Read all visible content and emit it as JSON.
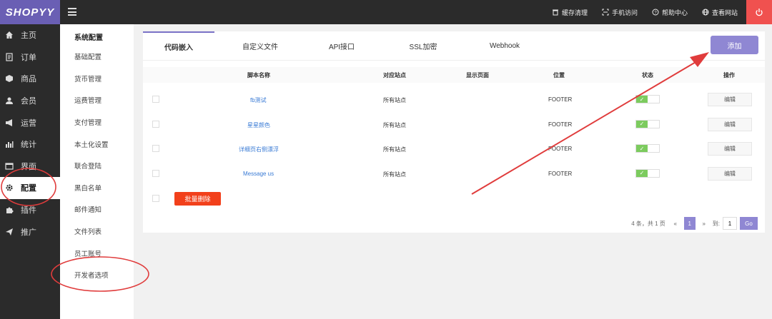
{
  "app": {
    "logo": "SHOPYY"
  },
  "topbar": {
    "links": [
      {
        "label": "缓存清理",
        "icon": "trash-icon"
      },
      {
        "label": "手机访问",
        "icon": "scan-icon"
      },
      {
        "label": "帮助中心",
        "icon": "help-icon"
      },
      {
        "label": "查看网站",
        "icon": "globe-icon"
      }
    ],
    "power_icon": "power-icon"
  },
  "sidebar": {
    "items": [
      {
        "label": "主页",
        "icon": "home-icon"
      },
      {
        "label": "订单",
        "icon": "order-icon"
      },
      {
        "label": "商品",
        "icon": "box-icon"
      },
      {
        "label": "会员",
        "icon": "user-icon"
      },
      {
        "label": "运营",
        "icon": "megaphone-icon"
      },
      {
        "label": "统计",
        "icon": "chart-icon"
      },
      {
        "label": "界面",
        "icon": "layout-icon"
      },
      {
        "label": "配置",
        "icon": "gear-icon"
      },
      {
        "label": "插件",
        "icon": "puzzle-icon"
      },
      {
        "label": "推广",
        "icon": "send-icon"
      }
    ]
  },
  "submenu": {
    "title": "系统配置",
    "items": [
      "基础配置",
      "货币管理",
      "运费管理",
      "支付管理",
      "本土化设置",
      "联合登陆",
      "黑白名单",
      "邮件通知",
      "文件列表",
      "员工账号",
      "开发者选项"
    ]
  },
  "tabs": [
    "代码嵌入",
    "自定义文件",
    "API接口",
    "SSL加密",
    "Webhook"
  ],
  "toolbar": {
    "add_label": "添加"
  },
  "table": {
    "headers": [
      "脚本名称",
      "对应站点",
      "显示页面",
      "位置",
      "状态",
      "操作"
    ],
    "rows": [
      {
        "name": "fb测试",
        "site": "所有站点",
        "page": "",
        "position": "FOOTER",
        "edit": "编辑"
      },
      {
        "name": "星星颜色",
        "site": "所有站点",
        "page": "",
        "position": "FOOTER",
        "edit": "编辑"
      },
      {
        "name": "详细页右侧漂浮",
        "site": "所有站点",
        "page": "",
        "position": "FOOTER",
        "edit": "编辑"
      },
      {
        "name": "Message us",
        "site": "所有站点",
        "page": "",
        "position": "FOOTER",
        "edit": "编辑"
      }
    ],
    "toggle_on": "✓",
    "bulk_delete": "批量删除"
  },
  "pagination": {
    "info": "4 条，共 1 页",
    "prev": "«",
    "current": "1",
    "next": "»",
    "goto_label": "到:",
    "goto_value": "1",
    "go": "Go"
  },
  "colors": {
    "brand": "#6a5fb4",
    "accent": "#8f87d3",
    "danger": "#f2401b",
    "annotation": "#e03c3c"
  }
}
